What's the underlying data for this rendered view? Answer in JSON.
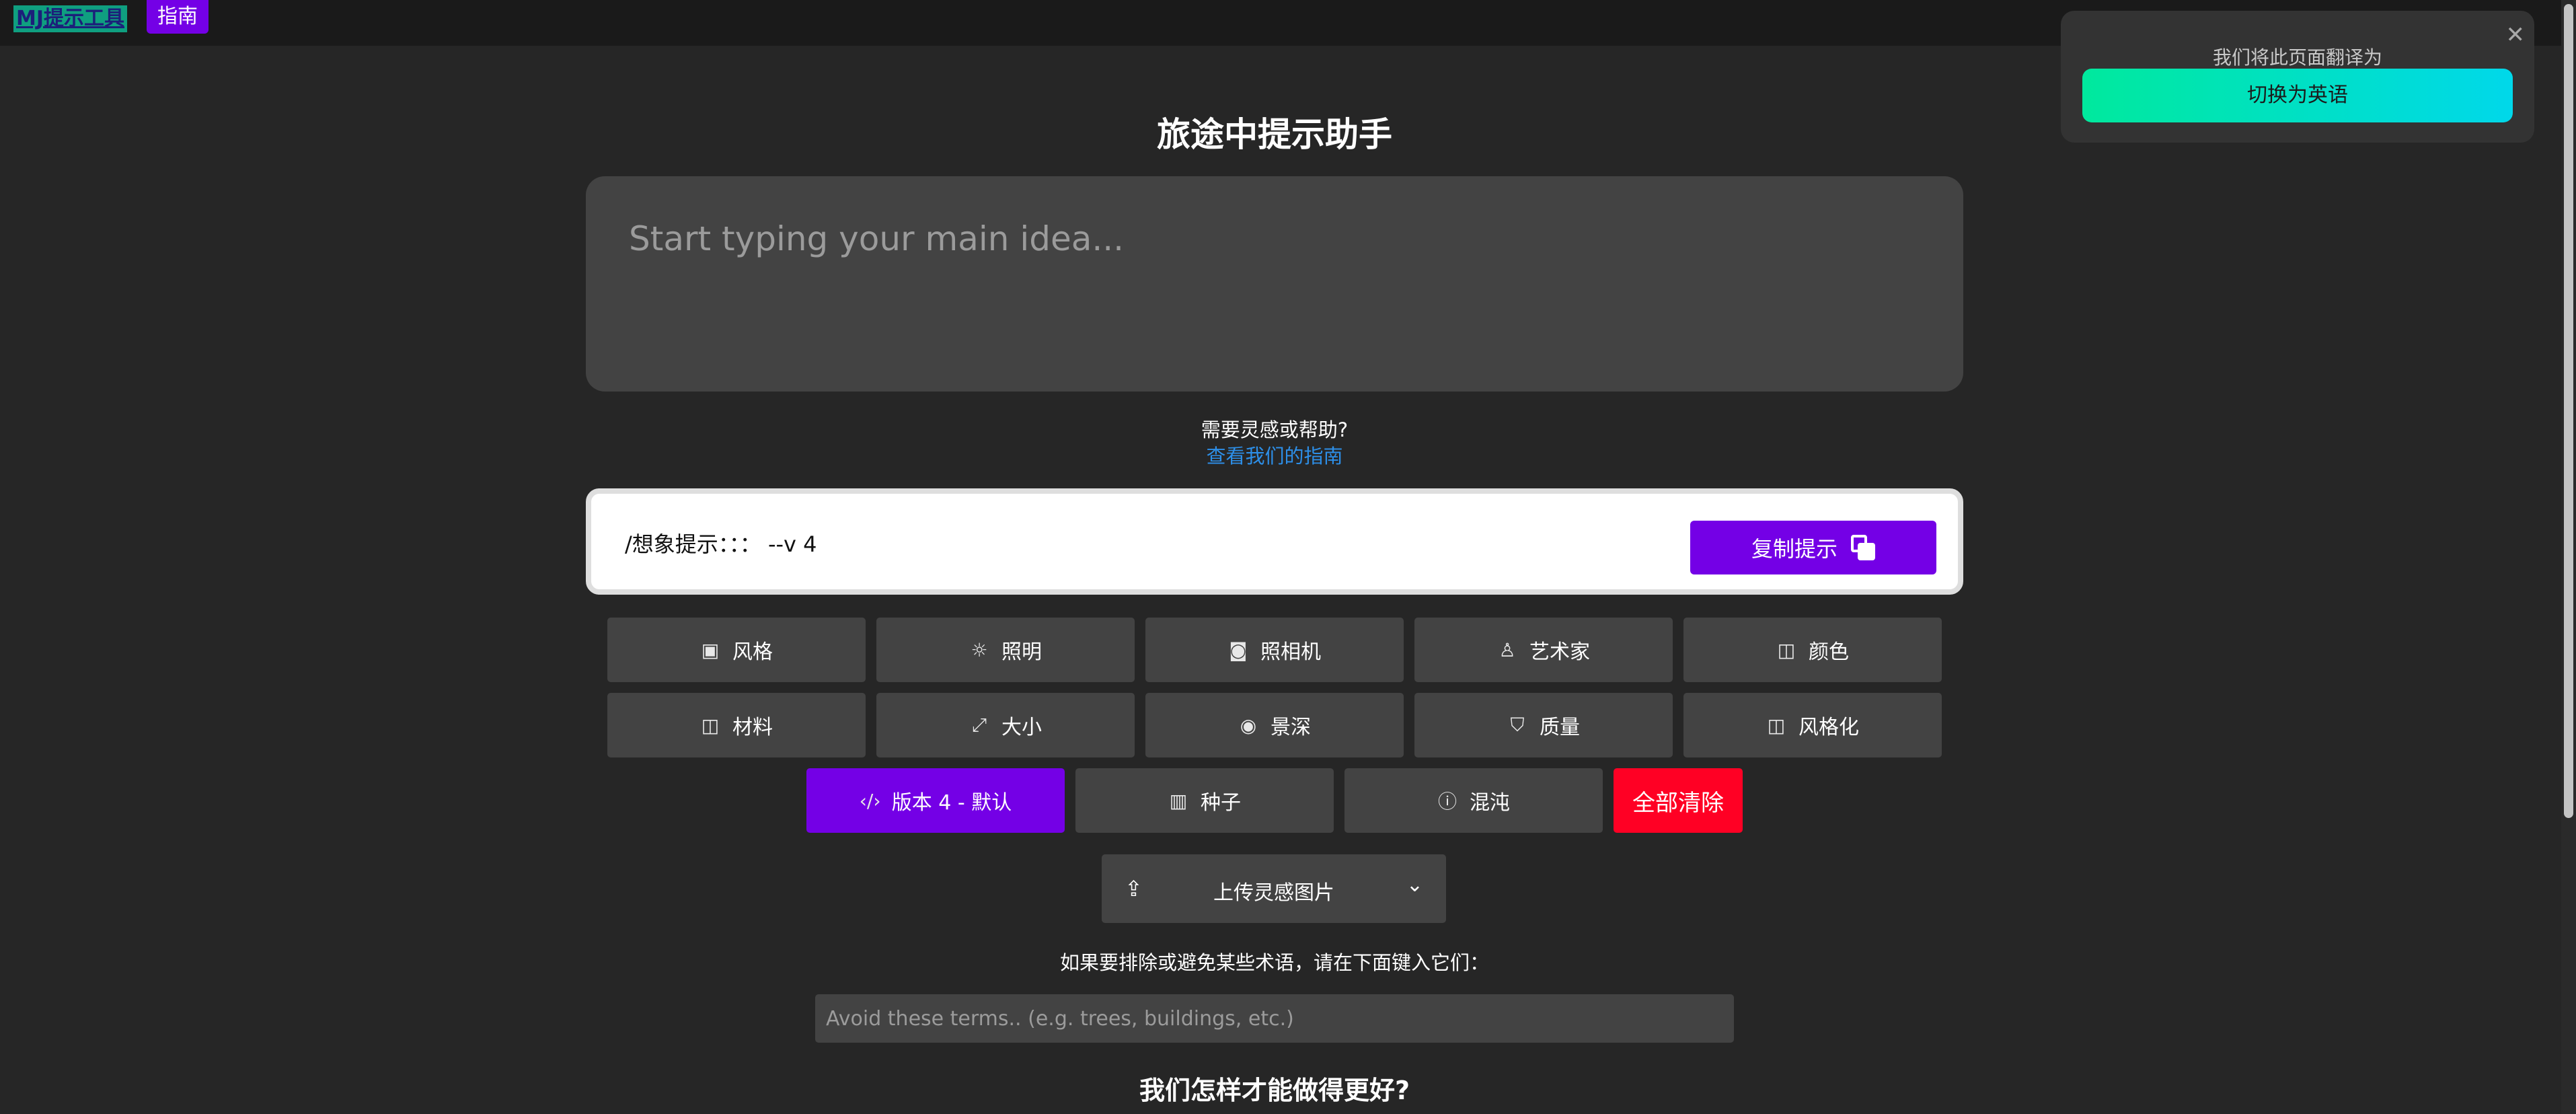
{
  "topbar": {
    "logo": "MJ提示工具",
    "guide": "指南"
  },
  "main": {
    "title": "旅途中提示助手",
    "idea_placeholder": "Start typing your main idea...",
    "help_question": "需要灵感或帮助?",
    "help_link": "查看我们的指南",
    "prompt_text": "/想象提示：：：  --v 4",
    "copy_label": "复制提示",
    "options_row1": [
      "风格",
      "照明",
      "照相机",
      "艺术家",
      "颜色"
    ],
    "options_row2": [
      "材料",
      "大小",
      "景深",
      "质量",
      "风格化"
    ],
    "version_label": "版本 4 - 默认",
    "seed_label": "种子",
    "chaos_label": "混沌",
    "clear_label": "全部清除",
    "upload_label": "上传灵感图片",
    "exclude_label": "如果要排除或避免某些术语，请在下面键入它们：",
    "exclude_placeholder": "Avoid these terms.. (e.g. trees, buildings, etc.)",
    "better_title": "我们怎样才能做得更好?"
  },
  "translate_popup": {
    "message": "我们将此页面翻译为",
    "switch_label": "切换为英语"
  },
  "colors": {
    "accent": "#7400e6",
    "danger": "#ff0024",
    "link": "#2d8fe8"
  }
}
